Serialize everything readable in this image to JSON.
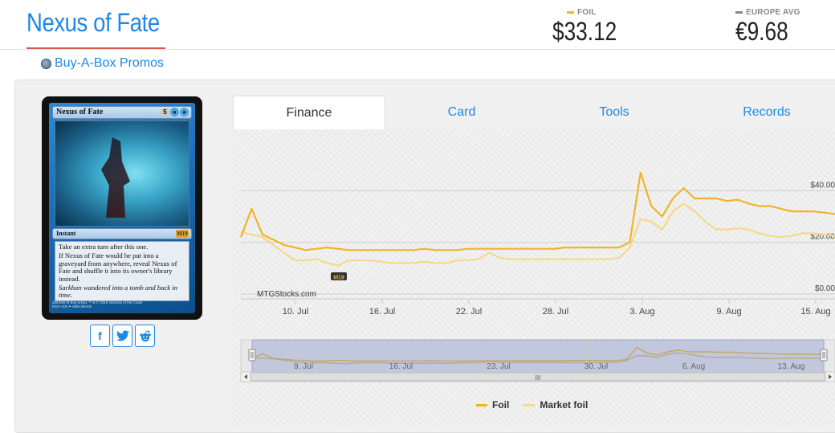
{
  "header": {
    "title": "Nexus of Fate",
    "prices": {
      "foil": {
        "label": "FOIL",
        "value": "$33.12",
        "color": "#f0b429"
      },
      "europe": {
        "label": "EUROPE AVG",
        "value": "€9.68",
        "color": "#888888"
      }
    }
  },
  "set": {
    "name": "Buy-A-Box Promos",
    "icon": "set-icon"
  },
  "card": {
    "name": "Nexus of Fate",
    "mana_cost": [
      "5",
      "U",
      "U"
    ],
    "type_line": "Instant",
    "set_symbol": "M19",
    "rules_text_1": "Take an extra turn after this one.",
    "rules_text_2": "If Nexus of Fate would be put into a graveyard from anywhere, reveal Nexus of Fate and shuffle it into its owner's library instead.",
    "flavor_text": "Sarkhan wandered into a tomb and back in time.",
    "footer_1": "306/280 M Buy-a-Box     ™ & © 2018 Wizards of the Coast",
    "footer_2": "M19 • EN  ✒ Mike Bierek"
  },
  "social": {
    "facebook": "f",
    "twitter": "t",
    "reddit": "r"
  },
  "tabs": [
    {
      "label": "Finance",
      "active": true
    },
    {
      "label": "Card",
      "active": false
    },
    {
      "label": "Tools",
      "active": false
    },
    {
      "label": "Records",
      "active": false
    }
  ],
  "chart_data": {
    "type": "line",
    "x_labels": [
      "10. Jul",
      "16. Jul",
      "22. Jul",
      "28. Jul",
      "3. Aug",
      "9. Aug",
      "15. Aug"
    ],
    "y_ticks": [
      "$0.00",
      "$20.00",
      "$40.00"
    ],
    "ylim": [
      0,
      60
    ],
    "watermark": "MTGStocks.com",
    "set_badge": "M19",
    "series": [
      {
        "name": "Foil",
        "color": "#f0b429",
        "values": [
          22,
          33,
          23,
          21,
          19,
          18,
          17,
          17.5,
          18,
          17.5,
          17,
          17,
          17,
          17,
          17,
          17,
          17,
          17.5,
          17,
          17,
          17,
          17.5,
          17.5,
          17.5,
          17.5,
          17.5,
          17.5,
          17.5,
          17.5,
          17.5,
          18,
          18,
          18,
          18,
          18,
          18,
          20,
          47,
          34,
          30,
          37,
          41,
          37,
          37,
          37,
          36,
          36.5,
          35,
          34,
          34,
          33,
          32,
          32,
          32,
          31.5,
          31
        ]
      },
      {
        "name": "Market foil",
        "color": "#f5d98a",
        "values": [
          24,
          23,
          22,
          19,
          16,
          13,
          13,
          13.5,
          12,
          11,
          13,
          13,
          13,
          12.5,
          12,
          12,
          12,
          12.5,
          12,
          12,
          13,
          13,
          13.5,
          16,
          14,
          13.5,
          13.5,
          13.5,
          13.5,
          13.5,
          13.5,
          13.5,
          13.5,
          13.5,
          13.5,
          14,
          18,
          29,
          28,
          25,
          32,
          35,
          32,
          28,
          25,
          25,
          25.5,
          25,
          23.5,
          22.5,
          22,
          22.5,
          23.5,
          23.5,
          23,
          22.5
        ]
      }
    ],
    "navigator": {
      "x_labels": [
        "9. Jul",
        "16. Jul",
        "23. Jul",
        "30. Jul",
        "6. Aug",
        "13. Aug"
      ],
      "scroll_label": "III"
    }
  }
}
